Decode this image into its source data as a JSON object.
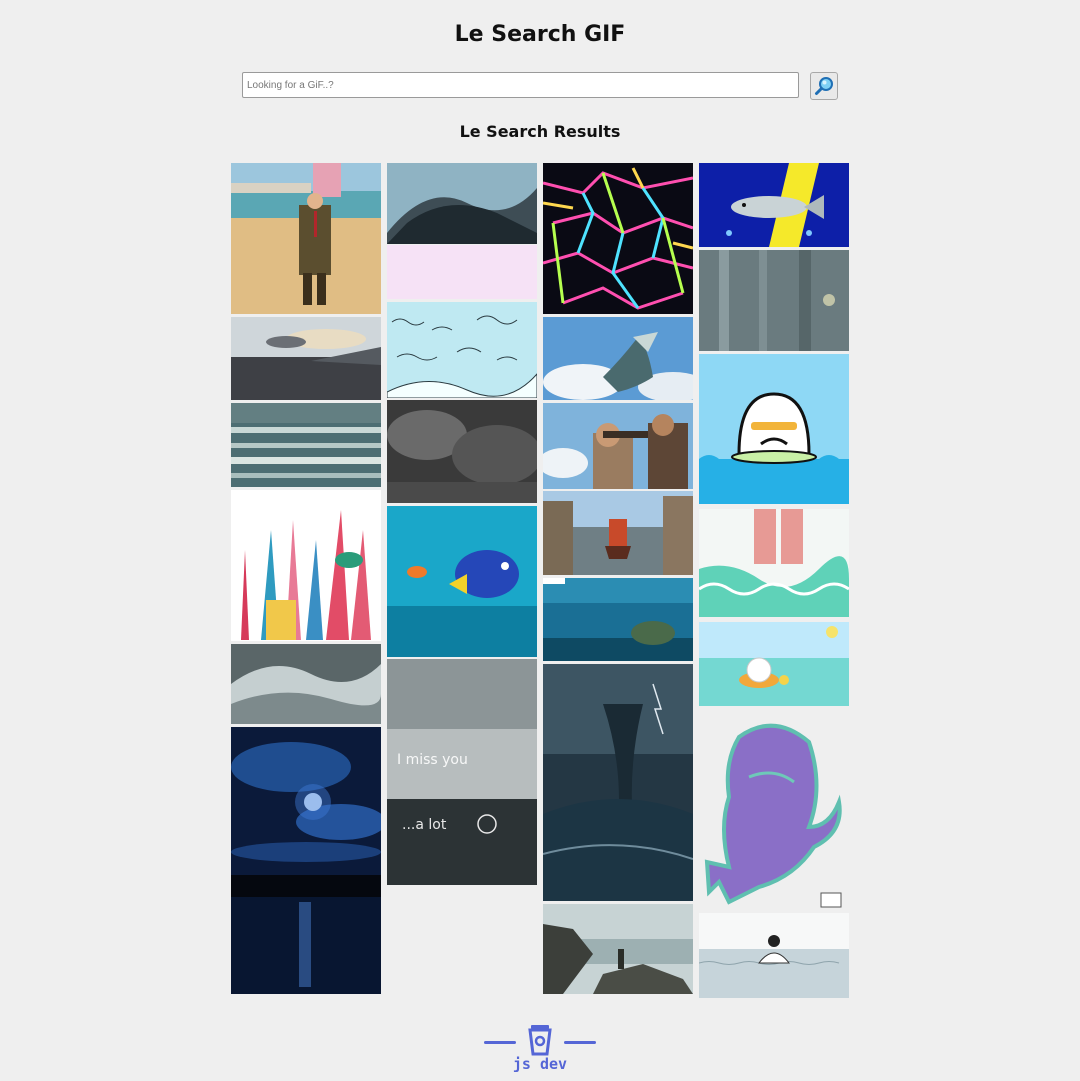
{
  "page": {
    "title": "Le Search GIF",
    "results_heading": "Le Search Results"
  },
  "search": {
    "placeholder": "Looking for a GiF..?",
    "value": "",
    "button_icon": "magnifier-icon"
  },
  "results": [
    "mr-bean-beach-walk",
    "ocean-sunset",
    "rolling-waves",
    "coral-reef-drawing",
    "crashing-surf",
    "moonlit-night-sea",
    "underwater-splash",
    "cartoon-sea-waves",
    "dark-storm-water",
    "dory-and-nemo",
    "i-miss-you-a-lot",
    "neon-caustic-network",
    "dragon-in-the-sky",
    "pirates-with-spyglass",
    "pirate-ship-harbor",
    "sea-turtle-underwater",
    "ocean-whirlpool",
    "rocky-shore",
    "flying-fish",
    "underwater-light-rays",
    "egg-character-with-sunglasses",
    "wading-feet",
    "bunny-floating-ring",
    "purple-mermaid-blob",
    "girl-swimming-sketch"
  ],
  "footer": {
    "brand": "js dev",
    "logo_icon": "coffee-cup-icon"
  },
  "colors": {
    "background": "#efefef",
    "brand": "#5566d6"
  }
}
